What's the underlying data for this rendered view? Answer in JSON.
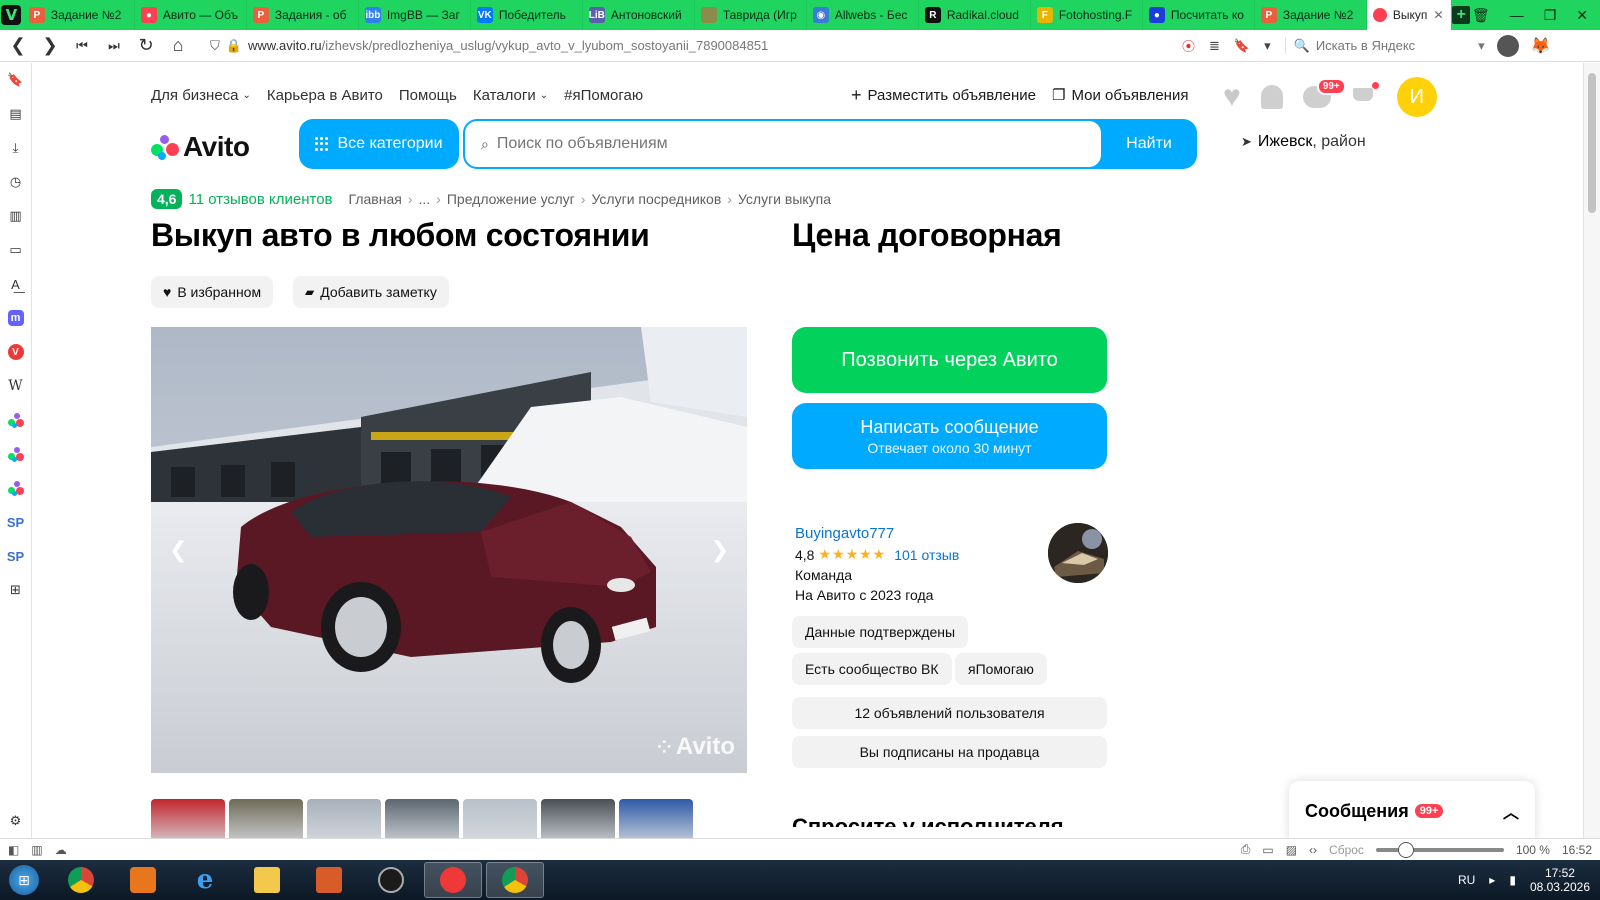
{
  "browser": {
    "tabs": [
      {
        "title": "Задание №2",
        "fav_color": "#e8613c",
        "fav_text": "P"
      },
      {
        "title": "Авито — Объ",
        "fav_color": "#ff4053",
        "fav_text": "●"
      },
      {
        "title": "Задания - об",
        "fav_color": "#e8613c",
        "fav_text": "P"
      },
      {
        "title": "ImgBB — Заг",
        "fav_color": "#2f80ed",
        "fav_text": "ibb"
      },
      {
        "title": "Победитель",
        "fav_color": "#0077ff",
        "fav_text": "VK"
      },
      {
        "title": "Антоновский",
        "fav_color": "#5b5fb0",
        "fav_text": "LiB"
      },
      {
        "title": "Таврида (Игр",
        "fav_color": "#8b8b4a",
        "fav_text": ""
      },
      {
        "title": "Allwebs - Бес",
        "fav_color": "#3a7bd5",
        "fav_text": "◉"
      },
      {
        "title": "Radikal.cloud",
        "fav_color": "#111111",
        "fav_text": "R"
      },
      {
        "title": "Fotohosting.F",
        "fav_color": "#e9b400",
        "fav_text": "F"
      },
      {
        "title": "Посчитать ко",
        "fav_color": "#1a3fd8",
        "fav_text": "●"
      },
      {
        "title": "Задание №2",
        "fav_color": "#e8613c",
        "fav_text": "P"
      }
    ],
    "active_tab": {
      "title": "Выкуп авто в",
      "fav_color": "#ff4053"
    },
    "url_host": "www.avito.ru",
    "url_path": "/izhevsk/predlozheniya_uslug/vykup_avto_v_lyubom_sostoyanii_7890084851",
    "search_placeholder": "Искать в Яндекс",
    "status": {
      "reset_label": "Сброс",
      "zoom": "100 %",
      "time": "16:52",
      "zoom_fraction": 0.2
    },
    "sidepanel": [
      {
        "name": "bookmarks-icon",
        "glyph": "🔖"
      },
      {
        "name": "reading-list-icon",
        "glyph": "▤"
      },
      {
        "name": "downloads-icon",
        "glyph": "⤓"
      },
      {
        "name": "history-icon",
        "glyph": "◷"
      },
      {
        "name": "notes-icon",
        "glyph": "▥"
      },
      {
        "name": "window-panel-icon",
        "glyph": "▭"
      },
      {
        "name": "translate-icon",
        "glyph": "A͟"
      },
      {
        "name": "mastodon-icon",
        "glyph": "m"
      },
      {
        "name": "vivaldi-icon",
        "glyph": "V"
      },
      {
        "name": "wikipedia-icon",
        "glyph": "W"
      },
      {
        "name": "avito-panel-icon-1",
        "glyph": "●"
      },
      {
        "name": "avito-panel-icon-2",
        "glyph": "●"
      },
      {
        "name": "avito-panel-icon-3",
        "glyph": "●"
      },
      {
        "name": "sp-panel-icon-1",
        "glyph": "SP"
      },
      {
        "name": "sp-panel-icon-2",
        "glyph": "SP"
      },
      {
        "name": "add-panel-icon",
        "glyph": "⊞"
      }
    ]
  },
  "avito": {
    "topnav": {
      "business": "Для бизнеса",
      "career": "Карьера в Авито",
      "help": "Помощь",
      "catalogs": "Каталоги",
      "ihelp": "#яПомогаю",
      "post_ad": "Разместить объявление",
      "my_ads": "Мои объявления",
      "chat_badge": "99+",
      "avatar_letter": "И"
    },
    "logo_text": "Avito",
    "all_categories": "Все категории",
    "search_placeholder": "Поиск по объявлениям",
    "search_button": "Найти",
    "location_city": "Ижевск",
    "location_suffix": ", район",
    "rating": "4,6",
    "reviews": "11 отзывов клиентов",
    "breadcrumbs": [
      "Главная",
      "...",
      "Предложение услуг",
      "Услуги посредников",
      "Услуги выкупа"
    ],
    "title": "Выкуп авто в любом состоянии",
    "price": "Цена договорная",
    "favorite_label": "В избранном",
    "note_label": "Добавить заметку",
    "photo_watermark": "Avito",
    "call_button": "Позвонить через Авито",
    "message_button": "Написать сообщение",
    "message_sub": "Отвечает около 30 минут",
    "seller": {
      "name": "Buyingavto777",
      "rating": "4,8",
      "stars": "★★★★★",
      "reviews": "101 отзыв",
      "type": "Команда",
      "since": "На Авито с 2023 года"
    },
    "tags": [
      "Данные подтверждены",
      "Есть сообщество ВК",
      "яПомогаю"
    ],
    "user_ads": "12 объявлений пользователя",
    "subscribed": "Вы подписаны на продавца",
    "cut_heading": "Спросите у исполнителя",
    "messages_panel": "Сообщения",
    "messages_badge": "99+",
    "thumb_colors": [
      "#c2262e",
      "#6f6a58",
      "#a8b0ba",
      "#5d6670",
      "#b9c0c9",
      "#4a4f56",
      "#2e5aa6"
    ]
  },
  "taskbar": {
    "lang": "RU",
    "time": "17:52",
    "date": "08.03.2026"
  }
}
